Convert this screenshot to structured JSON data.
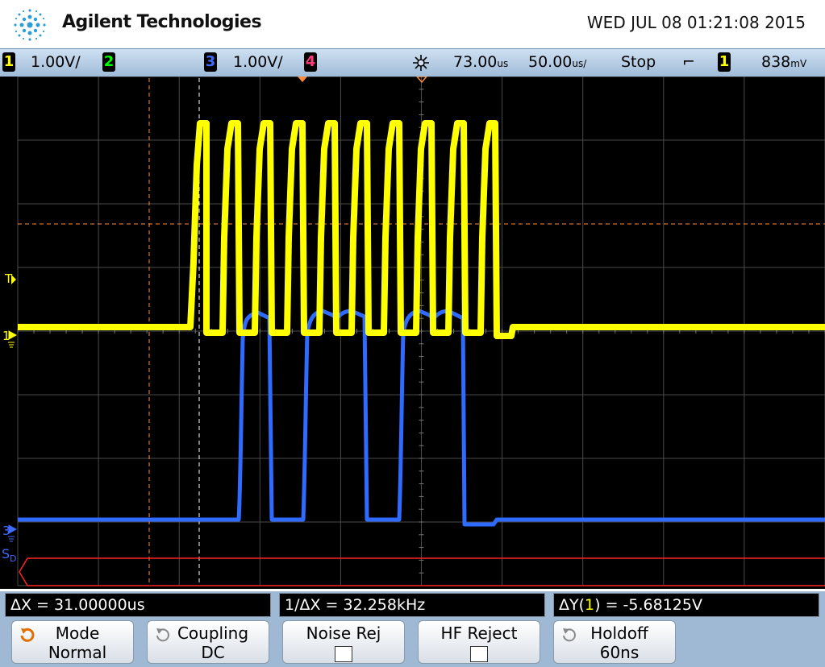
{
  "header": {
    "brand": "Agilent Technologies",
    "datetime": "WED JUL 08 01:21:08 2015"
  },
  "status": {
    "ch1_num": "1",
    "ch1_scale": "1.00V/",
    "ch2_num": "2",
    "ch3_num": "3",
    "ch3_scale": "1.00V/",
    "ch4_num": "4",
    "delay": "73.00",
    "delay_unit": "us",
    "timebase": "50.00",
    "timebase_unit": "us/",
    "run_state": "Stop",
    "trigger_slope": "⌐",
    "trigger_source": "1",
    "trigger_level": "838",
    "trigger_level_unit": "mV"
  },
  "markers": {
    "trigger": "T",
    "ch1": "1",
    "ch3": "3",
    "serial": "S",
    "serial_sub": "D"
  },
  "measurements": {
    "delta_x": "ΔX = 31.00000us",
    "inv_delta_x": "1/ΔX = 32.258kHz",
    "delta_y_pre": "ΔY(",
    "delta_y_ch": "1",
    "delta_y_post": ") = -5.68125V"
  },
  "softkeys": {
    "mode_label": "Mode",
    "mode_value": "Normal",
    "coupling_label": "Coupling",
    "coupling_value": "DC",
    "noise_label": "Noise Rej",
    "hf_label": "HF Reject",
    "holdoff_label": "Holdoff",
    "holdoff_value": "60ns"
  },
  "colors": {
    "ch1": "#ffff00",
    "ch3": "#2f6bff",
    "grid": "#555555",
    "cursor": "#ff9944"
  }
}
